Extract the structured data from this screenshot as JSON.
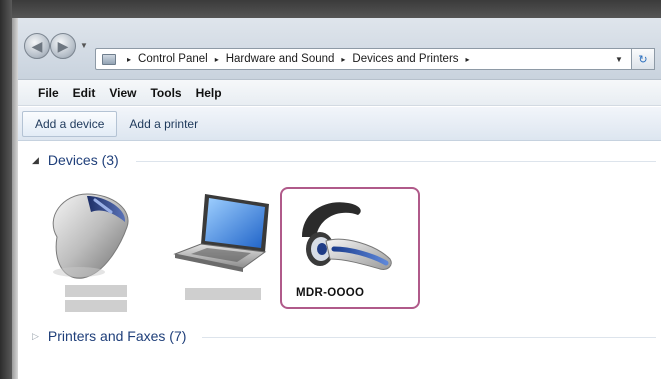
{
  "address_bar": {
    "breadcrumbs": [
      "Control Panel",
      "Hardware and Sound",
      "Devices and Printers"
    ],
    "separator": "▸"
  },
  "menu": [
    "File",
    "Edit",
    "View",
    "Tools",
    "Help"
  ],
  "command_bar": {
    "add_device": "Add a device",
    "add_printer": "Add a printer"
  },
  "groups": {
    "devices": "Devices (3)",
    "printers": "Printers and Faxes (7)"
  },
  "devices": [
    {
      "name": "",
      "icon": "mouse-icon"
    },
    {
      "name": "",
      "icon": "laptop-icon"
    },
    {
      "name": "MDR-OOOO",
      "icon": "headset-icon",
      "selected": true
    }
  ],
  "colors": {
    "selection_border": "#b05a8a",
    "group_header": "#1f3f7a"
  }
}
